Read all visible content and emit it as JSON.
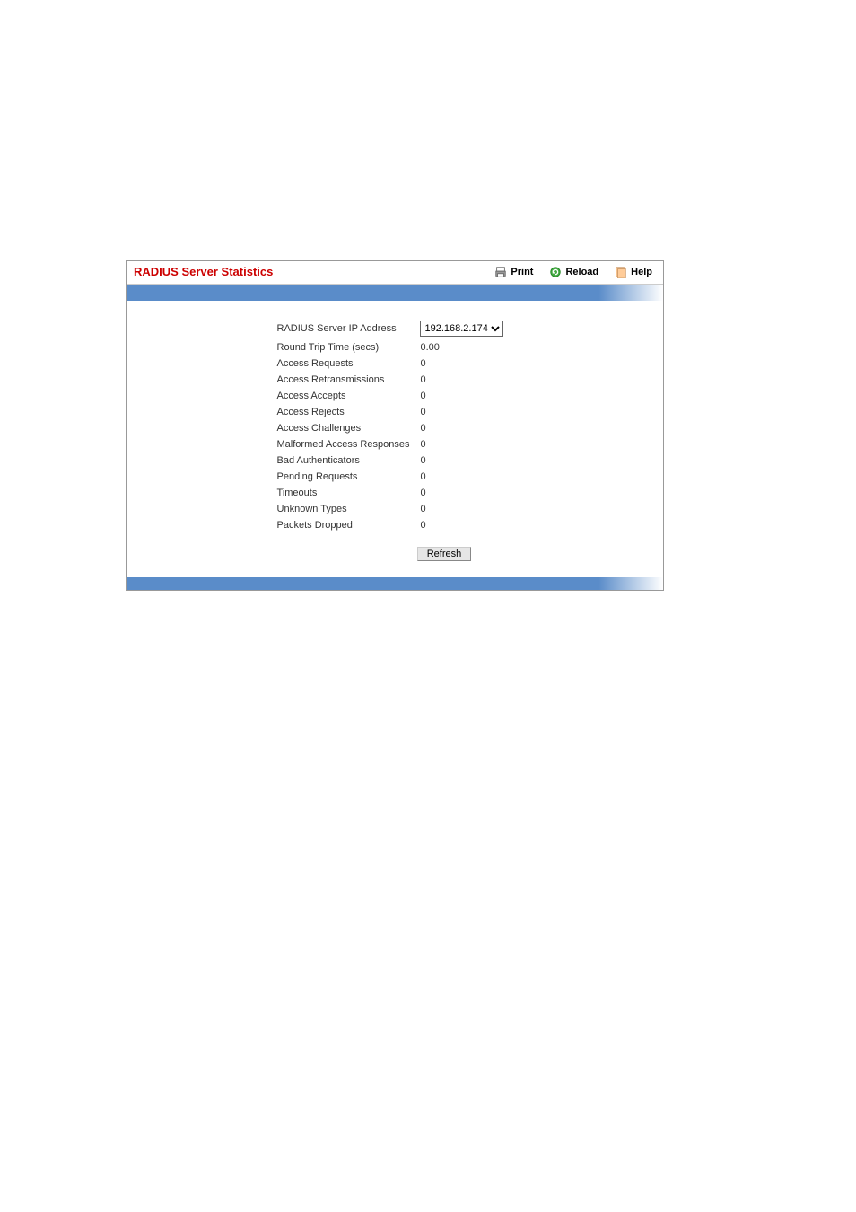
{
  "header": {
    "title": "RADIUS Server Statistics",
    "links": {
      "print": "Print",
      "reload": "Reload",
      "help": "Help"
    }
  },
  "stats": {
    "ip_label": "RADIUS Server IP Address",
    "ip_value": "192.168.2.174",
    "rows": [
      {
        "label": "Round Trip Time (secs)",
        "value": "0.00"
      },
      {
        "label": "Access Requests",
        "value": "0"
      },
      {
        "label": "Access Retransmissions",
        "value": "0"
      },
      {
        "label": "Access Accepts",
        "value": "0"
      },
      {
        "label": "Access Rejects",
        "value": "0"
      },
      {
        "label": "Access Challenges",
        "value": "0"
      },
      {
        "label": "Malformed Access Responses",
        "value": "0"
      },
      {
        "label": "Bad Authenticators",
        "value": "0"
      },
      {
        "label": "Pending Requests",
        "value": "0"
      },
      {
        "label": "Timeouts",
        "value": "0"
      },
      {
        "label": "Unknown Types",
        "value": "0"
      },
      {
        "label": "Packets Dropped",
        "value": "0"
      }
    ]
  },
  "buttons": {
    "refresh": "Refresh"
  }
}
